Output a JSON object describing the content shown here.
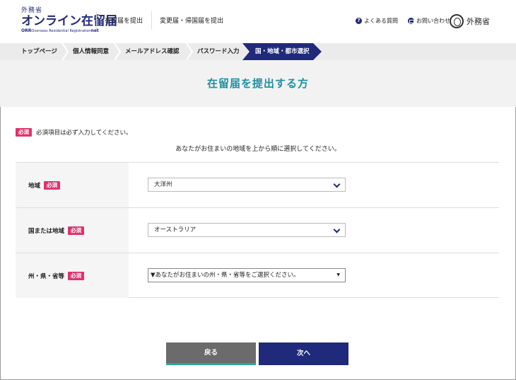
{
  "header": {
    "logo_top": "外務省",
    "logo_main": "オンライン在留届",
    "logo_sub_prefix": "ORR",
    "logo_sub": "Overseas Residential Registration",
    "logo_sub_suffix": "net",
    "nav": [
      "在留届を提出",
      "変更届・帰国届を提出"
    ],
    "faq": "よくある質問",
    "contact": "お問い合わせ",
    "mofa": "外務省"
  },
  "breadcrumb": {
    "items": [
      "トップページ",
      "個人情報同意",
      "メールアドレス確認",
      "パスワード入力"
    ],
    "active": "国・地域・都市選択"
  },
  "page": {
    "title": "在留届を提出する方",
    "required_badge": "必須",
    "required_note": "必須項目は必ず入力してください。",
    "instruction": "あなたがお住まいの地域を上から順に選択してください。"
  },
  "form": {
    "region_label": "地域",
    "region_value": "大洋州",
    "country_label": "国または地域",
    "country_value": "オーストラリア",
    "state_label": "州・県・省等",
    "state_value": "▼あなたがお住まいの州・県・省等をご選択ください。"
  },
  "buttons": {
    "back": "戻る",
    "next": "次へ"
  },
  "colors": {
    "navy": "#1f2a7a",
    "teal_title": "#1f8fa0",
    "required_pink": "#e0336e",
    "back_gray": "#6b6b6b"
  }
}
